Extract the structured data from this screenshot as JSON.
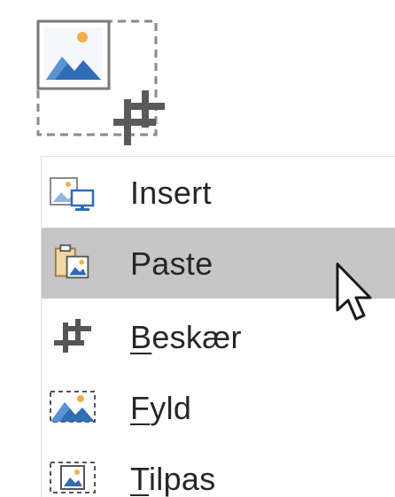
{
  "menu": {
    "items": [
      {
        "label": "Insert",
        "accelerator_index": -1,
        "icon": "insert-picture-from-device-icon",
        "hovered": false
      },
      {
        "label": "Paste",
        "accelerator_index": -1,
        "icon": "paste-picture-icon",
        "hovered": true
      },
      {
        "label": "Beskær",
        "accelerator_index": 0,
        "icon": "crop-icon",
        "hovered": false
      },
      {
        "label": "Fyld",
        "accelerator_index": 0,
        "icon": "fill-picture-icon",
        "hovered": false
      },
      {
        "label": "Tilpas",
        "accelerator_index": 0,
        "icon": "fit-picture-icon",
        "hovered": false
      }
    ]
  },
  "colors": {
    "hover_background": "#c6c6c6",
    "picture_blue": "#2f6db5",
    "sun_orange": "#f2b04c",
    "icon_gray": "#555555"
  }
}
